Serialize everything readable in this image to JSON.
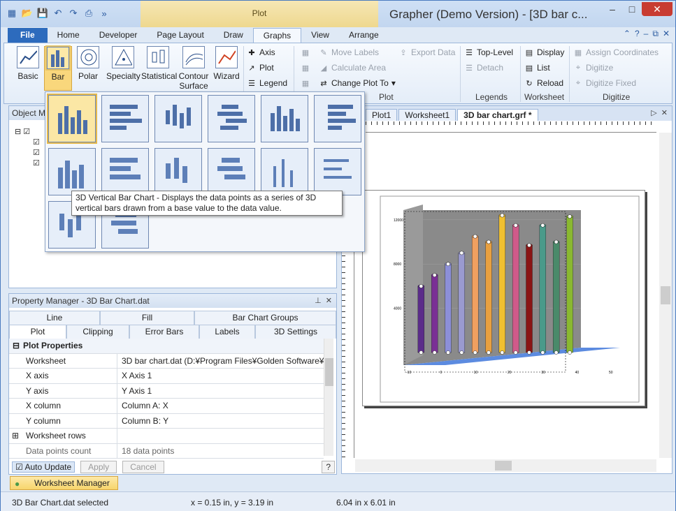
{
  "window": {
    "title": "Grapher (Demo Version) - [3D bar c...",
    "context_group": "Plot"
  },
  "tabs": [
    "File",
    "Home",
    "Developer",
    "Page Layout",
    "Draw",
    "Graphs",
    "View",
    "Arrange"
  ],
  "ribbon": {
    "graph_buttons": [
      "Basic",
      "Bar",
      "Polar",
      "Specialty",
      "Statistical",
      "Contour Surface",
      "Wizard"
    ],
    "add_items": [
      "Axis",
      "Plot",
      "Legend"
    ],
    "plot_items": [
      "Move Labels",
      "Calculate Area",
      "Change Plot To",
      "Export Data"
    ],
    "plot_group_label": "Plot",
    "legend_items": [
      "Top-Level",
      "Detach"
    ],
    "legends_group_label": "Legends",
    "worksheet_items": [
      "Display",
      "List",
      "Reload"
    ],
    "worksheet_group_label": "Worksheet",
    "digitize_items": [
      "Assign Coordinates",
      "Digitize",
      "Digitize Fixed"
    ],
    "digitize_group_label": "Digitize"
  },
  "object_manager": {
    "title": "Object M"
  },
  "tooltip": "3D Vertical Bar Chart - Displays the data points as a series of 3D vertical bars drawn from a base value to the data value.",
  "property_manager": {
    "title": "Property Manager - 3D Bar Chart.dat",
    "tabs_top": [
      "Line",
      "Fill",
      "Bar Chart Groups"
    ],
    "tabs_bottom": [
      "Plot",
      "Clipping",
      "Error Bars",
      "Labels",
      "3D Settings"
    ],
    "section": "Plot Properties",
    "rows": [
      {
        "k": "Worksheet",
        "v": "3D bar chart.dat (D:¥Program Files¥Golden Software¥"
      },
      {
        "k": "X axis",
        "v": "X Axis 1"
      },
      {
        "k": "Y axis",
        "v": "Y Axis 1"
      },
      {
        "k": "X column",
        "v": "Column A: X"
      },
      {
        "k": "Y column",
        "v": "Column B: Y"
      },
      {
        "k": "Worksheet rows",
        "v": ""
      },
      {
        "k": "Data points count",
        "v": "18 data points"
      }
    ],
    "auto_update": "Auto Update",
    "apply": "Apply",
    "cancel": "Cancel",
    "help": "?"
  },
  "worksheet_manager": "Worksheet Manager",
  "doc_tabs": [
    "Plot1",
    "Worksheet1",
    "3D bar chart.grf *"
  ],
  "status": {
    "left": "3D Bar Chart.dat selected",
    "coords": "x = 0.15 in, y = 3.19 in",
    "size": "6.04 in x 6.01 in"
  },
  "chart_data": {
    "type": "bar",
    "y_ticks": [
      "12000",
      "8000",
      "4000"
    ],
    "x_ticks": [
      "-10",
      "0",
      "10",
      "20",
      "30",
      "40",
      "50"
    ],
    "x": [
      -9,
      -5,
      -1,
      3,
      7,
      11,
      15,
      19,
      23,
      27,
      31,
      35,
      39
    ],
    "values": [
      6000,
      7000,
      8000,
      9000,
      10500,
      10000,
      12400,
      11500,
      9700,
      11500,
      10000,
      12300,
      0
    ],
    "colors": [
      "#5b2c8a",
      "#7a2f95",
      "#8c8fd8",
      "#9a9ad0",
      "#f0a060",
      "#e8a040",
      "#f0c030",
      "#d05a8a",
      "#8a1414",
      "#4a9a8a",
      "#4a8a6a",
      "#8ab830"
    ]
  }
}
